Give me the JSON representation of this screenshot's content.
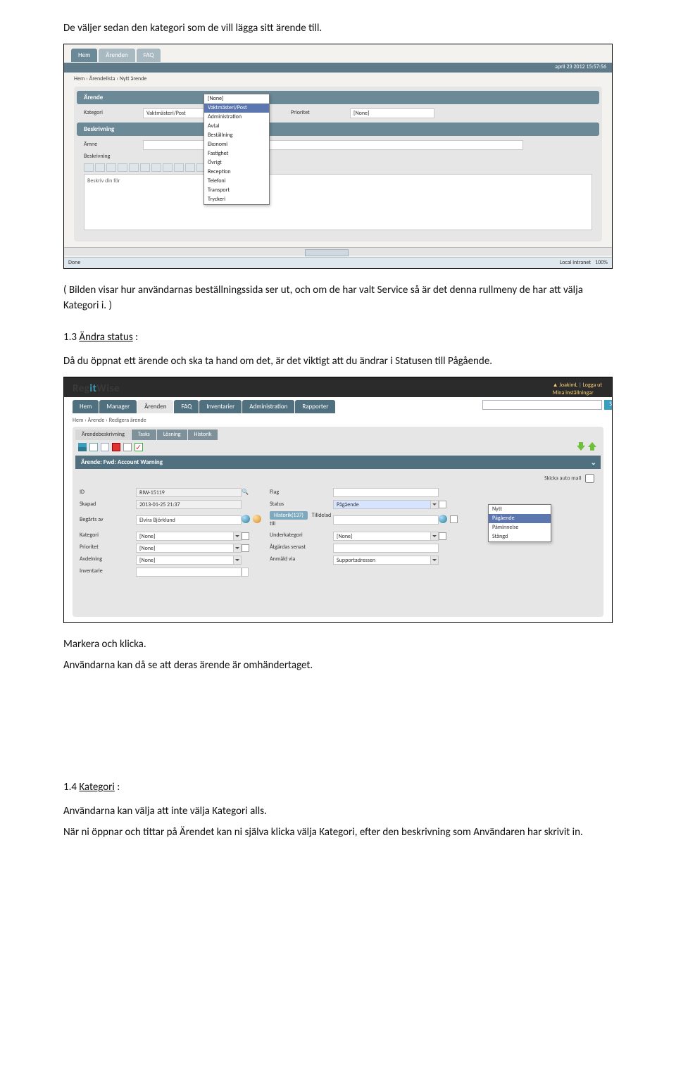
{
  "doc": {
    "p1": "De väljer sedan den kategori som de vill lägga sitt ärende till.",
    "p2": "( Bilden visar hur användarnas beställningssida ser ut, och om de har valt Service så är det denna rullmeny de har att välja Kategori i. )",
    "h13_num": "1.3 ",
    "h13_label": "Ändra status",
    "h13_colon": " :",
    "p3": "Då du öppnat ett ärende och ska ta hand om det, är det viktigt att du ändrar i Statusen till Pågående.",
    "p4": "Markera och klicka.",
    "p5": "Användarna kan då se att deras ärende är omhändertaget.",
    "h14_num": "1.4 ",
    "h14_label": "Kategori",
    "h14_colon": " :",
    "p6": "Användarna kan välja att inte välja Kategori alls.",
    "p7": "När ni öppnar och tittar på Ärendet kan ni själva klicka välja Kategori, efter den beskrivning som Användaren har skrivit in."
  },
  "ss1": {
    "tabs": {
      "hem": "Hem",
      "arenden": "Ärenden",
      "faq": "FAQ"
    },
    "dateBar": "april 23 2012 15:57:56",
    "breadcrumb": "Hem › Ärendelista › Nytt ärende",
    "section1": "Ärende",
    "labels": {
      "kategori": "Kategori",
      "prioritet": "Prioritet"
    },
    "values": {
      "kategori": "Vaktmästeri/Post",
      "prioritet": "[None]"
    },
    "section2": "Beskrivning",
    "labels2": {
      "amne": "Ämne",
      "beskr": "Beskrivning"
    },
    "editorPlaceholder": "Beskriv din för",
    "dropdown": {
      "none": "[None]",
      "opt1": "Vaktmästeri/Post",
      "opt2": "Administration",
      "opt3": "Avtal",
      "opt4": "Beställning",
      "opt5": "Ekonomi",
      "opt6": "Fastighet",
      "opt7": "Övrigt",
      "opt8": "Reception",
      "opt9": "Telefoni",
      "opt10": "Transport",
      "opt11": "Tryckeri"
    },
    "status": {
      "done": "Done",
      "intranet": "Local intranet",
      "zoom": "100%"
    }
  },
  "ss2": {
    "brand1": "Reg",
    "brandIT": "it",
    "brand2": "Wise",
    "user": "JoakimL",
    "logout": "Logga ut",
    "settings": "Mina inställningar",
    "searchBtn": "Sök",
    "tabs": {
      "hem": "Hem",
      "manager": "Manager",
      "arenden": "Ärenden",
      "faq": "FAQ",
      "inv": "Inventarier",
      "admin": "Administration",
      "rapp": "Rapporter"
    },
    "breadcrumb": "Hem › Ärende › Redigera ärende",
    "subtabs": {
      "desc": "Ärendebeskrivning",
      "tasks": "Tasks",
      "losning": "Lösning",
      "hist": "Historik"
    },
    "title": "Ärende: Fwd: Account Warning",
    "automail": "Skicka auto mail",
    "fields": {
      "id_l": "ID",
      "id_v": "RIW-15119",
      "skapad_l": "Skapad",
      "skapad_v": "2013-01-25 21:37",
      "begarts_l": "Begärts av",
      "begarts_v": "Elvira Björklund",
      "kategori_l": "Kategori",
      "kategori_v": "[None]",
      "prioritet_l": "Prioritet",
      "prioritet_v": "[None]",
      "avdelning_l": "Avdelning",
      "avdelning_v": "[None]",
      "inventarie_l": "Inventarie",
      "inventarie_v": "",
      "flag_l": "Flag",
      "status_l": "Status",
      "status_v": "Pågående",
      "tilldelad_l": "Tilldelad till",
      "underkat_l": "Underkategori",
      "underkat_v": "[None]",
      "atgardas_l": "Åtgärdas senast",
      "anmald_l": "Anmäld via",
      "anmald_v": "Supportadressen",
      "histBtn": "Historik(137)"
    },
    "statusOptions": {
      "o1": "Nytt",
      "o2": "Pågående",
      "o3": "Påminnelse",
      "o4": "Stängd"
    }
  }
}
